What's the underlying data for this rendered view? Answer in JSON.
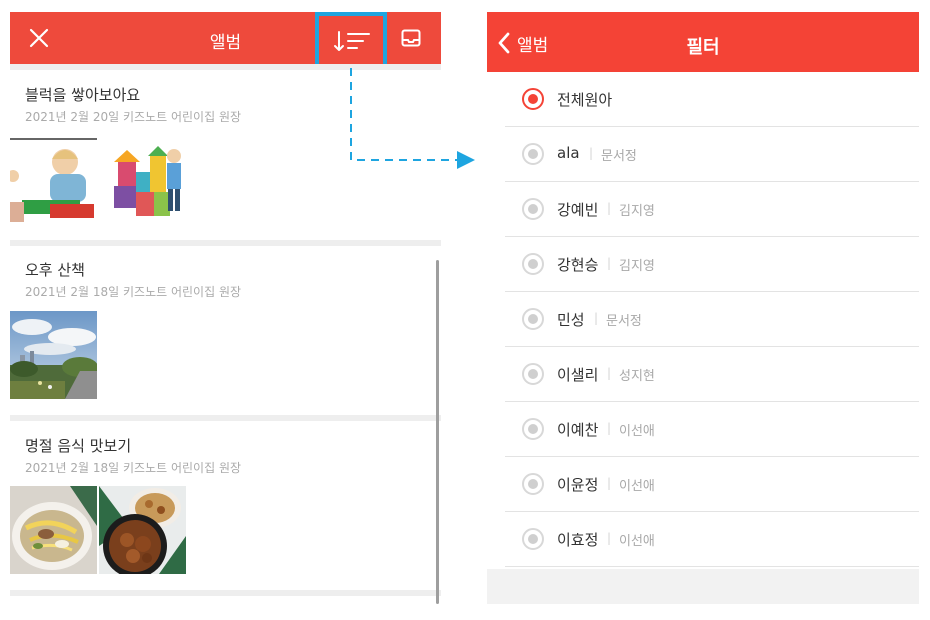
{
  "album": {
    "title": "앨범",
    "posts": [
      {
        "title": "블럭을 쌓아보아요",
        "subtitle": "2021년 2월 20일 키즈노트 어린이집 원장",
        "photos": [
          "children-playing-blocks-photo"
        ]
      },
      {
        "title": "오후 산책",
        "subtitle": "2021년 2월 18일 키즈노트 어린이집 원장",
        "photos": [
          "park-walk-photo"
        ]
      },
      {
        "title": "명절 음식 맛보기",
        "subtitle": "2021년 2월 18일 키즈노트 어린이집 원장",
        "photos": [
          "noodle-soup-photo",
          "food-plates-photo"
        ]
      }
    ]
  },
  "filter": {
    "back_label": "앨범",
    "title": "필터",
    "items": [
      {
        "name": "전체원아",
        "teacher": "",
        "selected": true
      },
      {
        "name": "ala",
        "teacher": "문서정",
        "selected": false
      },
      {
        "name": "강예빈",
        "teacher": "김지영",
        "selected": false
      },
      {
        "name": "강현승",
        "teacher": "김지영",
        "selected": false
      },
      {
        "name": "민성",
        "teacher": "문서정",
        "selected": false
      },
      {
        "name": "이샐리",
        "teacher": "성지현",
        "selected": false
      },
      {
        "name": "이예찬",
        "teacher": "이선애",
        "selected": false
      },
      {
        "name": "이윤정",
        "teacher": "이선애",
        "selected": false
      },
      {
        "name": "이효정",
        "teacher": "이선애",
        "selected": false
      }
    ]
  },
  "colors": {
    "header_left": "#ee4a3c",
    "header_right": "#f44336",
    "highlight": "#1ea5e0"
  },
  "icons": {
    "close": "close-icon",
    "sort": "sort-filter-icon",
    "inbox": "inbox-icon",
    "back": "chevron-left-icon"
  }
}
